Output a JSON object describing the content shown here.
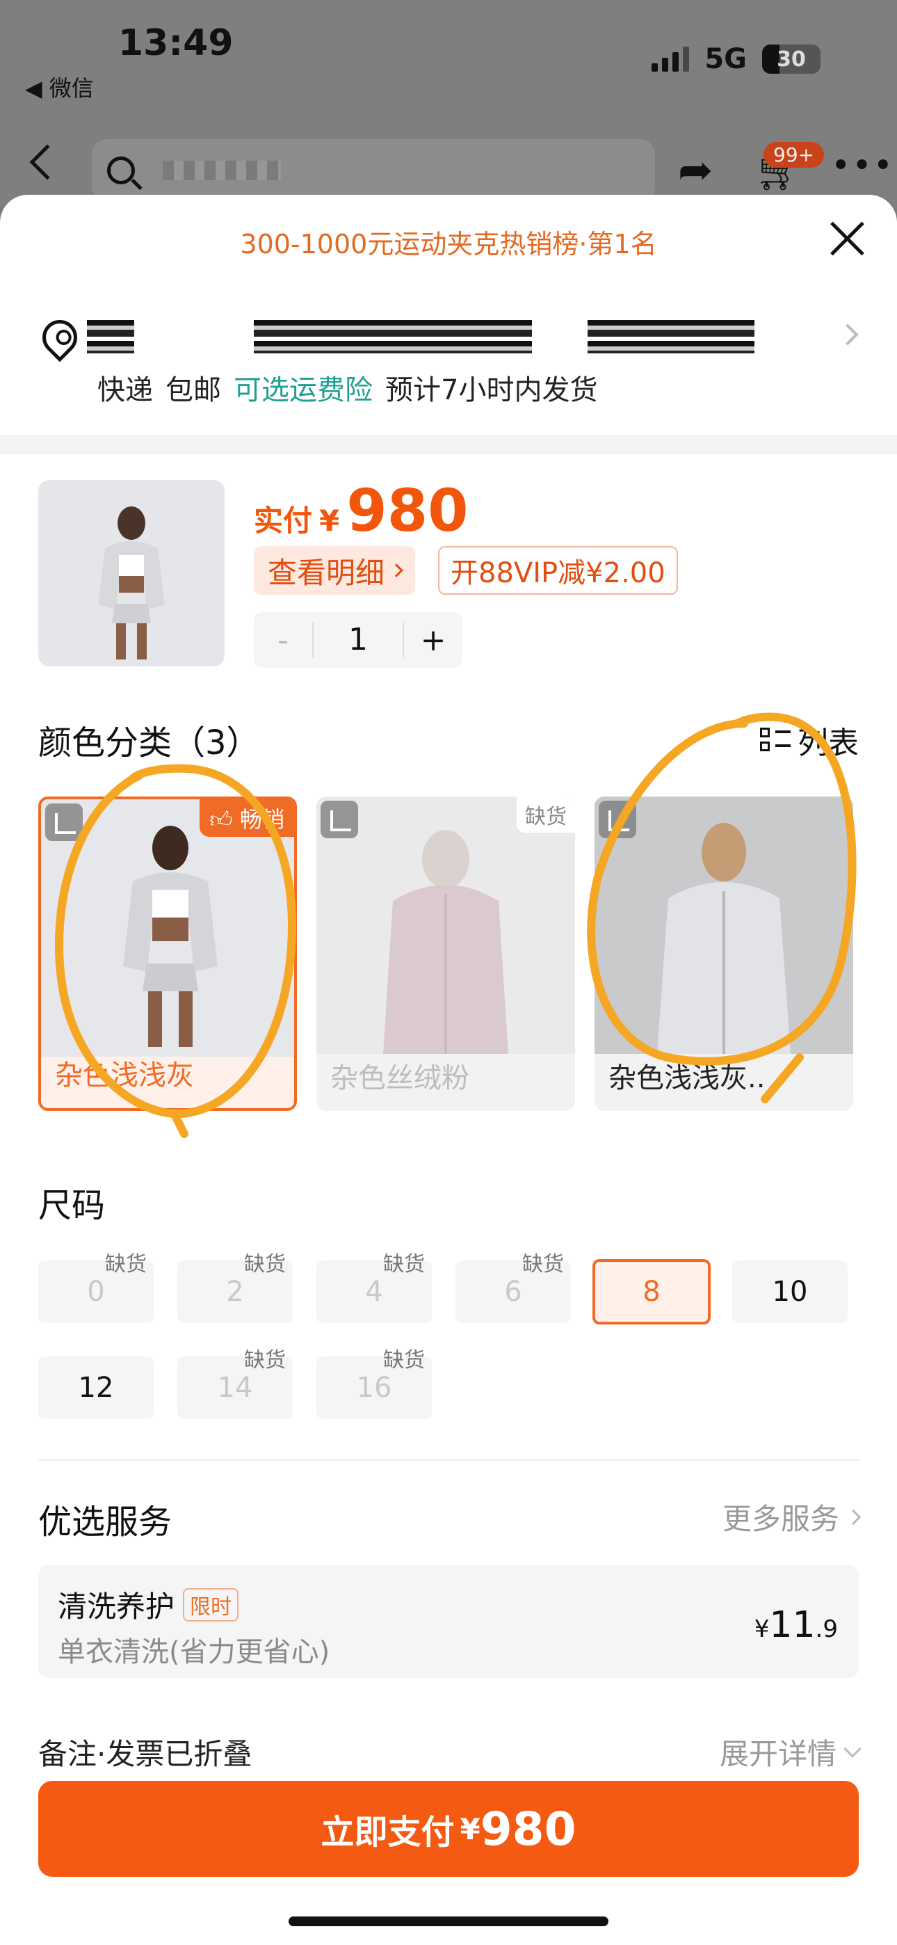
{
  "status_bar": {
    "time": "13:49",
    "back_app": "◀ 微信",
    "network": "5G",
    "battery": "30"
  },
  "nav": {
    "cart_badge": "99+"
  },
  "sheet": {
    "rank_text": "300-1000元运动夹克热销榜·第1名",
    "shipping": {
      "express": "快递",
      "free_ship": "包邮",
      "insurance": "可选运费险",
      "eta": "预计7小时内发货"
    },
    "product": {
      "price_label": "实付",
      "currency": "¥",
      "price": "980",
      "detail_button": "查看明细",
      "vip_button": "开88VIP减¥2.00",
      "quantity": "1",
      "minus": "-",
      "plus": "+"
    },
    "colors": {
      "title": "颜色分类（3）",
      "list_toggle": "列表",
      "items": [
        {
          "name": "杂色浅浅灰",
          "tag": "畅销",
          "state": "selected"
        },
        {
          "name": "杂色丝绒粉",
          "tag": "缺货",
          "state": "out-of-stock"
        },
        {
          "name": "杂色浅浅灰..",
          "tag": "",
          "state": "available"
        }
      ]
    },
    "sizes": {
      "title": "尺码",
      "oos_label": "缺货",
      "items": [
        {
          "label": "0",
          "state": "oos"
        },
        {
          "label": "2",
          "state": "oos"
        },
        {
          "label": "4",
          "state": "oos"
        },
        {
          "label": "6",
          "state": "oos"
        },
        {
          "label": "8",
          "state": "selected"
        },
        {
          "label": "10",
          "state": "available"
        },
        {
          "label": "12",
          "state": "available"
        },
        {
          "label": "14",
          "state": "oos"
        },
        {
          "label": "16",
          "state": "oos"
        }
      ]
    },
    "services": {
      "title": "优选服务",
      "more": "更多服务",
      "card": {
        "title": "清洗养护",
        "badge": "限时",
        "subtitle": "单衣清洗(省力更省心)",
        "price_currency": "¥",
        "price_int": "11",
        "price_dec": ".9"
      }
    },
    "notes": {
      "label": "备注·发票已折叠",
      "expand": "展开详情"
    },
    "pay_button": {
      "label": "立即支付",
      "currency": "¥",
      "amount": "980"
    }
  },
  "colors_theme": {
    "accent": "#f55a13",
    "teal": "#1f9f92",
    "scribble": "#f5a623"
  }
}
